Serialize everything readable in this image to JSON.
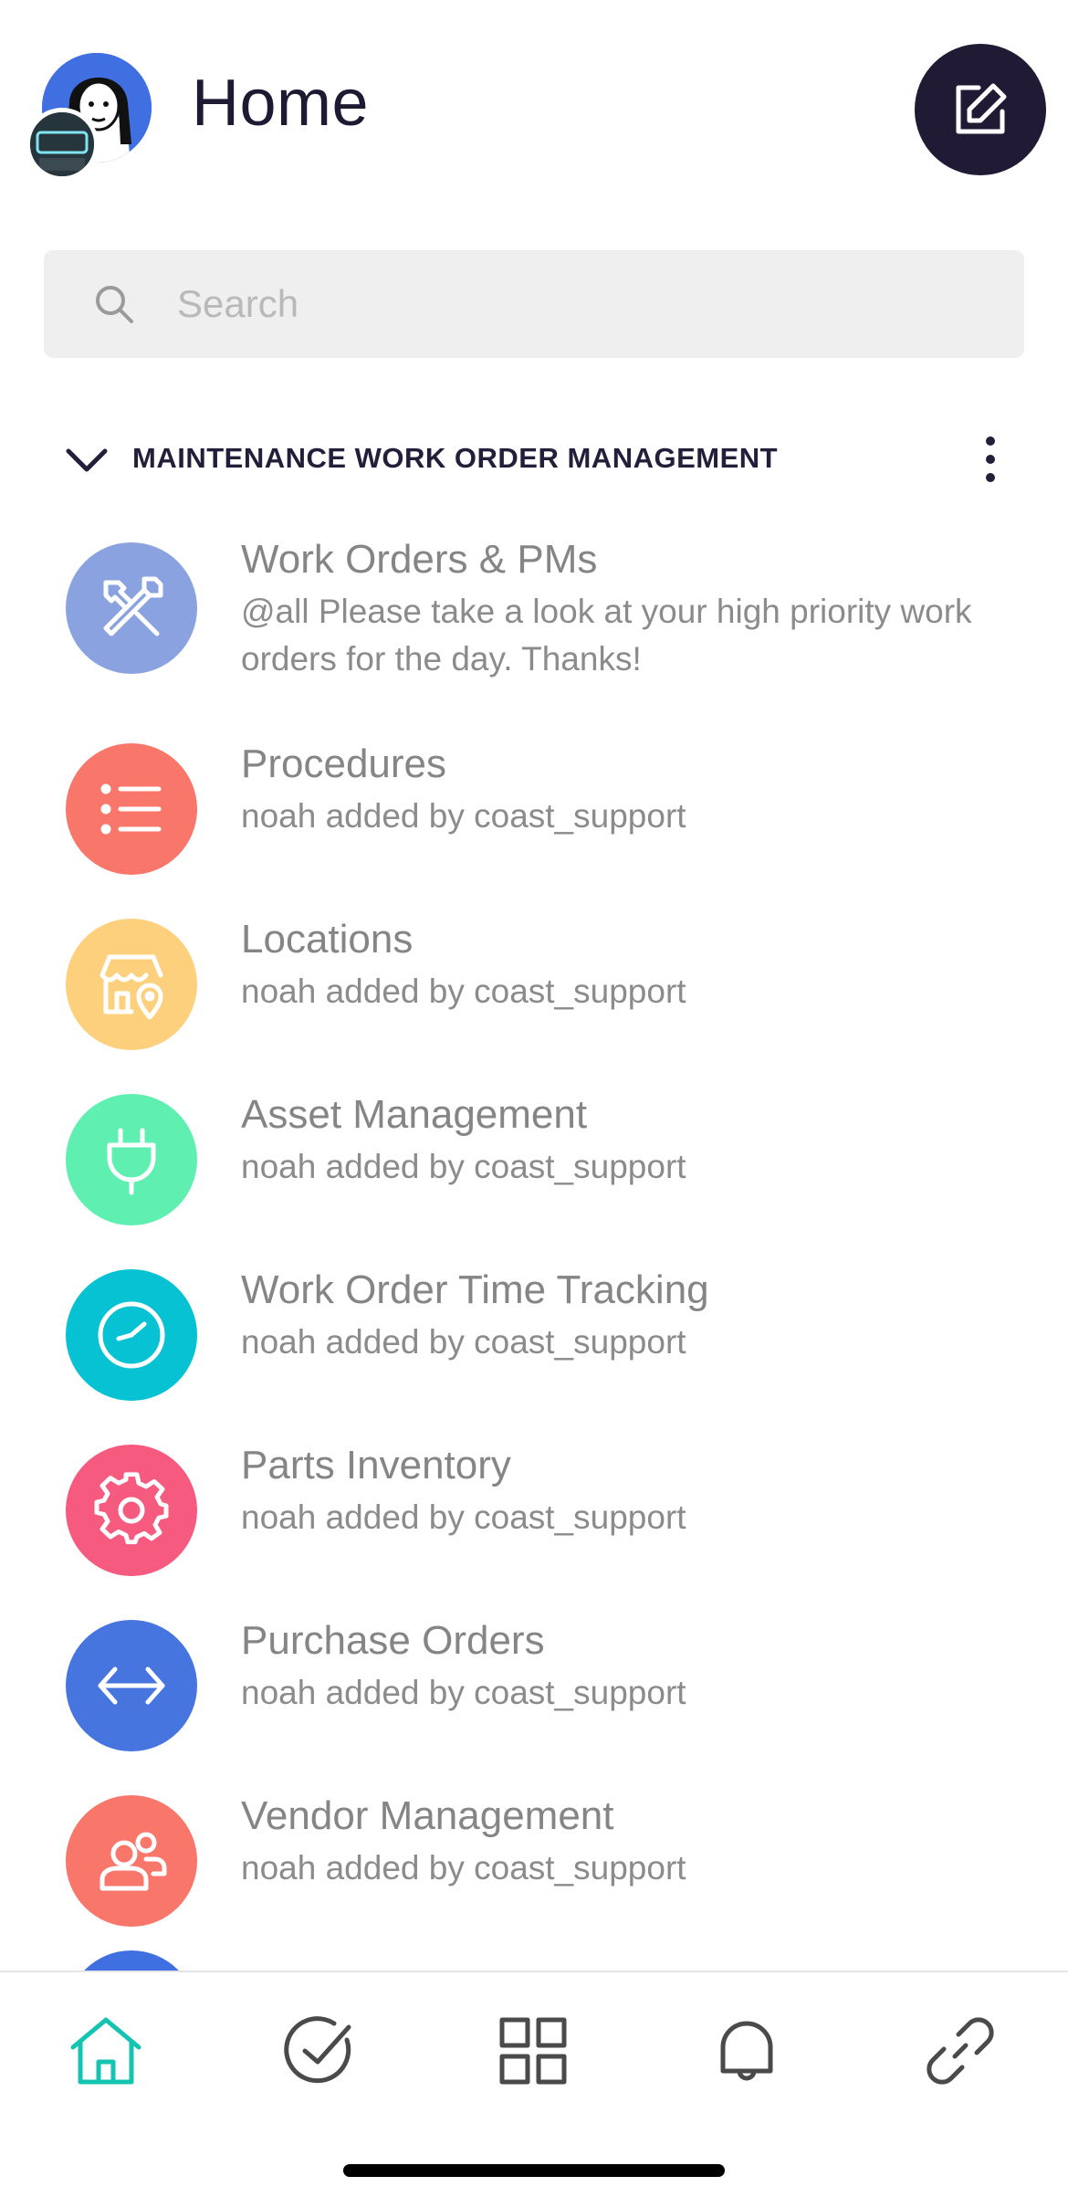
{
  "header": {
    "title": "Home",
    "compose_icon": "compose-icon"
  },
  "search": {
    "placeholder": "Search",
    "icon": "search-icon"
  },
  "section": {
    "title": "MAINTENANCE WORK ORDER MANAGEMENT",
    "collapse_icon": "chevron-down-icon",
    "more_icon": "more-vertical-icon"
  },
  "channels": [
    {
      "name": "Work Orders & PMs",
      "preview": "@all Please take a look at your high priority work orders for the day. Thanks!",
      "icon": "tools-icon",
      "color": "#8aa2df"
    },
    {
      "name": "Procedures",
      "preview": "noah added by coast_support",
      "icon": "list-icon",
      "color": "#f9776a"
    },
    {
      "name": "Locations",
      "preview": "noah added by coast_support",
      "icon": "store-location-icon",
      "color": "#fdd07d"
    },
    {
      "name": "Asset Management",
      "preview": "noah added by coast_support",
      "icon": "plug-icon",
      "color": "#5ff0b1"
    },
    {
      "name": "Work Order Time Tracking",
      "preview": "noah added by coast_support",
      "icon": "clock-icon",
      "color": "#06c2d3"
    },
    {
      "name": "Parts Inventory",
      "preview": "noah added by coast_support",
      "icon": "gear-icon",
      "color": "#f65a7f"
    },
    {
      "name": "Purchase Orders",
      "preview": "noah added by coast_support",
      "icon": "exchange-arrows-icon",
      "color": "#4775e0"
    },
    {
      "name": "Vendor Management",
      "preview": "noah added by coast_support",
      "icon": "users-icon",
      "color": "#f9776a"
    }
  ],
  "bottom_nav": [
    {
      "icon": "home-icon",
      "active": true,
      "color": "#14c3b0"
    },
    {
      "icon": "check-circle-icon",
      "active": false,
      "color": "#4a4a4a"
    },
    {
      "icon": "grid-icon",
      "active": false,
      "color": "#4a4a4a"
    },
    {
      "icon": "bell-icon",
      "active": false,
      "color": "#4a4a4a"
    },
    {
      "icon": "link-icon",
      "active": false,
      "color": "#4a4a4a"
    }
  ],
  "colors": {
    "accent": "#14c3b0",
    "dark": "#211a35"
  }
}
